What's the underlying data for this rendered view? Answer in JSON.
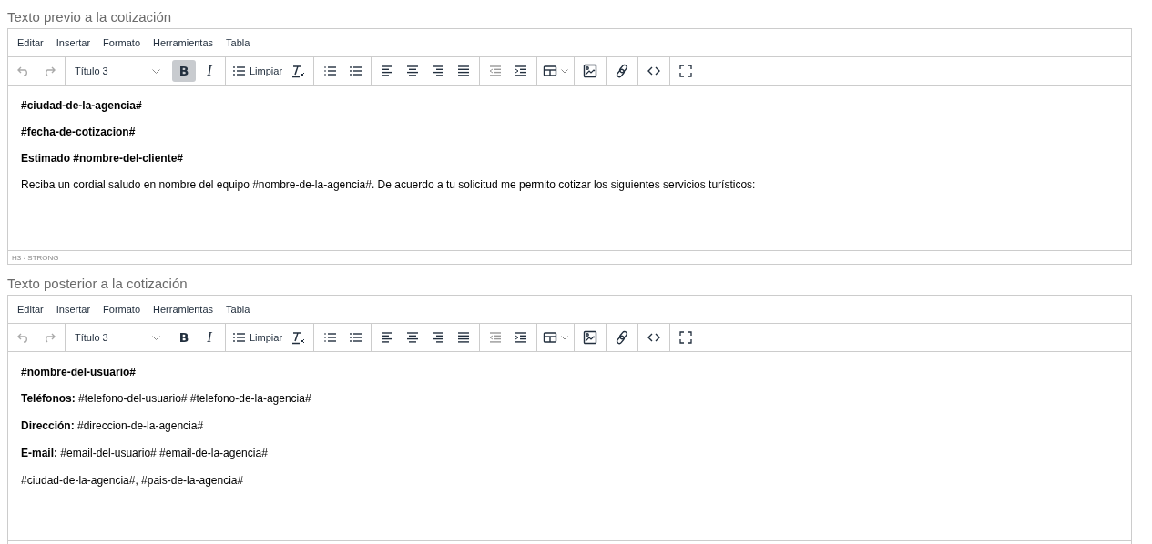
{
  "editors": [
    {
      "label": "Texto previo a la cotización",
      "menu": [
        "Editar",
        "Insertar",
        "Formato",
        "Herramientas",
        "Tabla"
      ],
      "toolbar": {
        "block_format": "Título 3",
        "bold": {
          "label": "B",
          "selected": true
        },
        "italic": {
          "label": "I",
          "selected": false
        },
        "list_label": "Limpiar"
      },
      "paragraphs": [
        {
          "kind": "heading",
          "text": "#ciudad-de-la-agencia#"
        },
        {
          "kind": "heading",
          "text": "#fecha-de-cotizacion#"
        },
        {
          "kind": "heading",
          "text": "Estimado #nombre-del-cliente#"
        },
        {
          "kind": "text",
          "text": "Reciba un cordial saludo en nombre del equipo #nombre-de-la-agencia#. De acuerdo a tu solicitud me permito cotizar los siguientes servicios turísticos:"
        }
      ],
      "status_path": "H3 › STRONG"
    },
    {
      "label": "Texto posterior a la cotización",
      "menu": [
        "Editar",
        "Insertar",
        "Formato",
        "Herramientas",
        "Tabla"
      ],
      "toolbar": {
        "block_format": "Título 3",
        "bold": {
          "label": "B",
          "selected": false
        },
        "italic": {
          "label": "I",
          "selected": false
        },
        "list_label": "Limpiar"
      },
      "paragraphs": [
        {
          "kind": "heading",
          "text": "#nombre-del-usuario#"
        },
        {
          "kind": "text",
          "text": "**Teléfonos:** #telefono-del-usuario# #telefono-de-la-agencia#"
        },
        {
          "kind": "text",
          "text": "**Dirección:** #direccion-de-la-agencia#"
        },
        {
          "kind": "text",
          "text": "**E-mail:** #email-del-usuario# #email-de-la-agencia#"
        },
        {
          "kind": "text",
          "text": "#ciudad-de-la-agencia#, #pais-de-la-agencia#"
        }
      ]
    }
  ]
}
